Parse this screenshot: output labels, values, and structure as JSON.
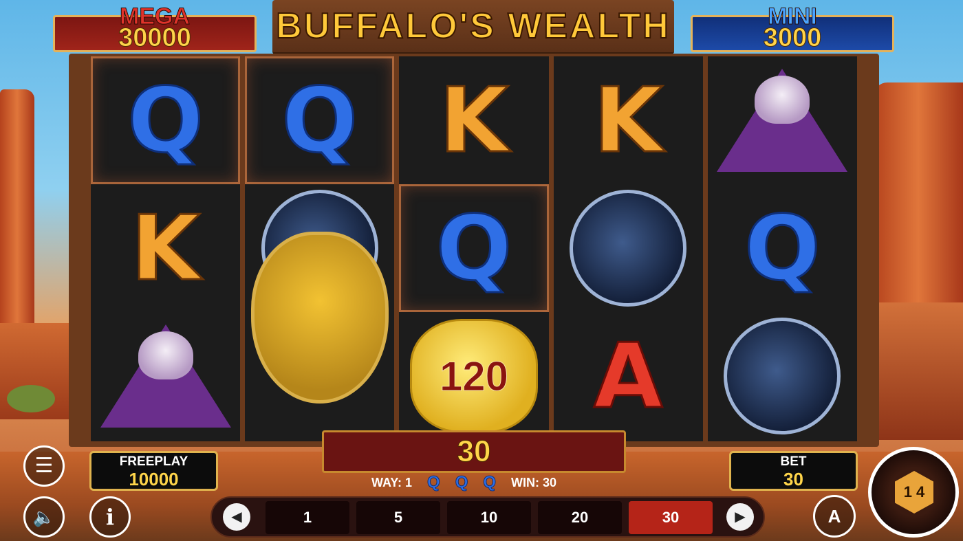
{
  "jackpots": {
    "mega": {
      "label": "MEGA",
      "value": "30000"
    },
    "mini": {
      "label": "MINI",
      "value": "3000"
    }
  },
  "title": "BUFFALO'S WEALTH",
  "reels": [
    [
      "Q",
      "K",
      "eagle"
    ],
    [
      "Q",
      "panther",
      "buffalo"
    ],
    [
      "K",
      "Q",
      "coin"
    ],
    [
      "K",
      "panther",
      "A"
    ],
    [
      "eagle",
      "Q",
      "panther"
    ]
  ],
  "coin_value": "120",
  "win_display": "30",
  "freeplay": {
    "label": "FREEPLAY",
    "value": "10000"
  },
  "bet": {
    "label": "BET",
    "value": "30"
  },
  "way_info": {
    "way_label": "WAY: 1",
    "symbols": [
      "Q",
      "Q",
      "Q"
    ],
    "win_label": "WIN: 30"
  },
  "bet_options": [
    "1",
    "5",
    "10",
    "20",
    "30"
  ],
  "selected_bet": "30",
  "icons": {
    "menu": "hamburger-menu-icon",
    "sound": "speaker-icon",
    "info": "info-icon",
    "prev": "left-arrow-icon",
    "next": "right-arrow-icon",
    "autoplay": "autoplay-icon",
    "spin": "spin-icon"
  },
  "spin_button_text": "1 4",
  "autoplay_text": "A"
}
